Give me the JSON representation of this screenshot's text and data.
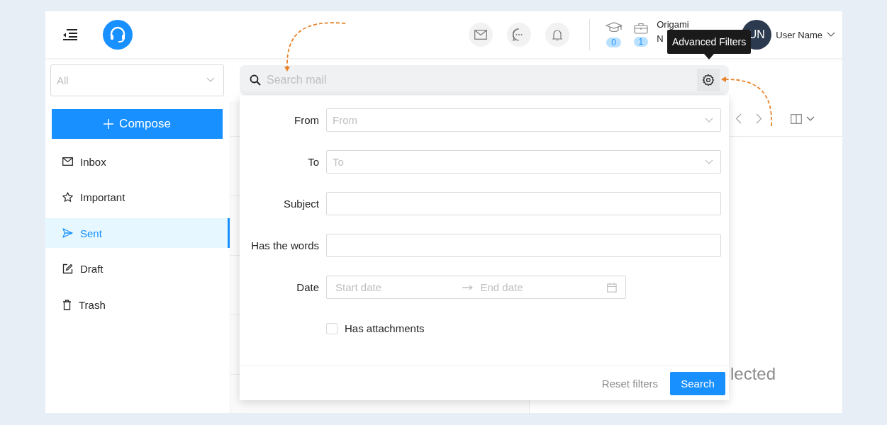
{
  "header": {
    "badges": [
      {
        "kind": "education",
        "count": "0"
      },
      {
        "kind": "work",
        "count": "1"
      }
    ],
    "org_name": [
      "Origami",
      "N"
    ],
    "user": {
      "initials": "UN",
      "name": "User Name"
    }
  },
  "folder_select": {
    "value": "All"
  },
  "search": {
    "placeholder": "Search mail"
  },
  "tooltip": "Advanced Filters",
  "compose": "Compose",
  "folders": [
    {
      "kind": "inbox",
      "label": "Inbox",
      "selected": false
    },
    {
      "kind": "important",
      "label": "Important",
      "selected": false
    },
    {
      "kind": "sent",
      "label": "Sent",
      "selected": true
    },
    {
      "kind": "draft",
      "label": "Draft",
      "selected": false
    },
    {
      "kind": "trash",
      "label": "Trash",
      "selected": false
    }
  ],
  "reading_pane": {
    "message": "lected"
  },
  "filters": {
    "fields": [
      {
        "kind": "select",
        "label": "From",
        "placeholder": "From"
      },
      {
        "kind": "select",
        "label": "To",
        "placeholder": "To"
      },
      {
        "kind": "text",
        "label": "Subject"
      },
      {
        "kind": "text",
        "label": "Has the words"
      },
      {
        "kind": "daterange",
        "label": "Date",
        "start_placeholder": "Start date",
        "end_placeholder": "End date"
      }
    ],
    "has_attachments": {
      "label": "Has attachments",
      "checked": false
    },
    "reset": "Reset filters",
    "submit": "Search"
  }
}
